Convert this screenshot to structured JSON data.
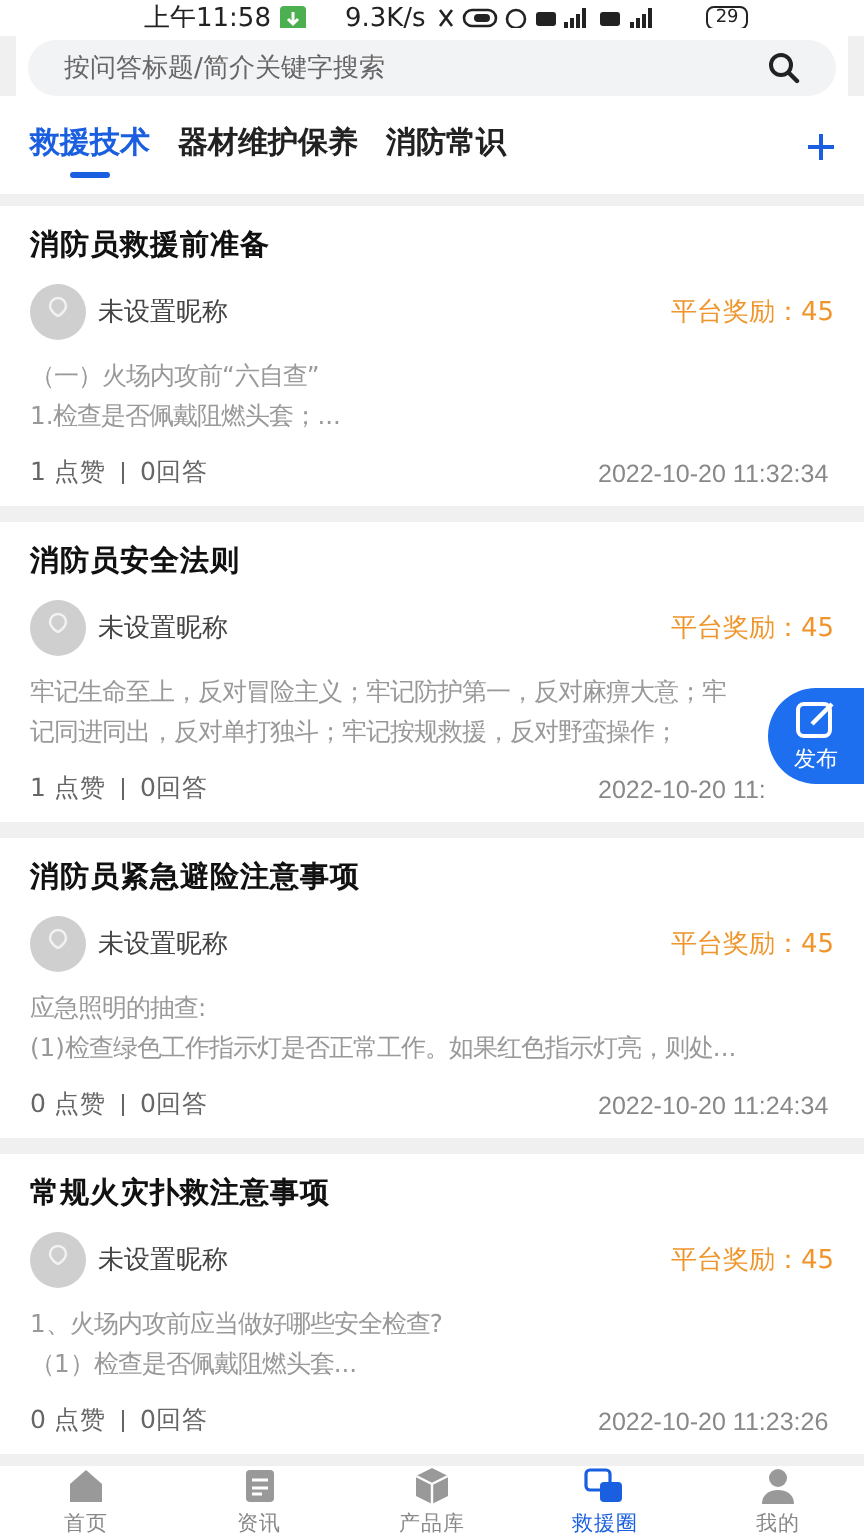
{
  "status_bar": {
    "time": "上午11:58",
    "speed": "9.3K/s",
    "battery": "29"
  },
  "search": {
    "placeholder": "按问答标题/简介关键字搜索"
  },
  "tabs": [
    {
      "label": "救援技术",
      "selected": true
    },
    {
      "label": "器材维护保养",
      "selected": false
    },
    {
      "label": "消防常识",
      "selected": false
    }
  ],
  "posts": [
    {
      "title": "消防员救援前准备",
      "author": "未设置昵称",
      "reward": "平台奖励：45",
      "lines": [
        "（一）火场内攻前“六自查”",
        "1.检查是否佩戴阻燃头套；..."
      ],
      "likes": "1 点赞",
      "answers": "0回答",
      "date": "2022-10-20 11:32:34"
    },
    {
      "title": "消防员安全法则",
      "author": "未设置昵称",
      "reward": "平台奖励：45",
      "lines": [
        "牢记生命至上，反对冒险主义；牢记防护第一，反对麻痹大意；牢",
        "记同进同出，反对单打独斗；牢记按规救援，反对野蛮操作；"
      ],
      "likes": "1 点赞",
      "answers": "0回答",
      "date": "2022-10-20 11:"
    },
    {
      "title": "消防员紧急避险注意事项",
      "author": "未设置昵称",
      "reward": "平台奖励：45",
      "lines": [
        "应急照明的抽查:",
        "(1)检查绿色工作指示灯是否正常工作。如果红色指示灯亮，则处..."
      ],
      "likes": "0 点赞",
      "answers": "0回答",
      "date": "2022-10-20 11:24:34"
    },
    {
      "title": "常规火灾扑救注意事项",
      "author": "未设置昵称",
      "reward": "平台奖励：45",
      "lines": [
        "1、火场内攻前应当做好哪些安全检查?",
        "（1）检查是否佩戴阻燃头套..."
      ],
      "likes": "0 点赞",
      "answers": "0回答",
      "date": "2022-10-20 11:23:26"
    }
  ],
  "fab": {
    "label": "发布"
  },
  "nav": [
    {
      "label": "首页",
      "kind": "home",
      "selected": false
    },
    {
      "label": "资讯",
      "kind": "news",
      "selected": false
    },
    {
      "label": "产品库",
      "kind": "box",
      "selected": false
    },
    {
      "label": "救援圈",
      "kind": "chat",
      "selected": true
    },
    {
      "label": "我的",
      "kind": "user",
      "selected": false
    }
  ]
}
